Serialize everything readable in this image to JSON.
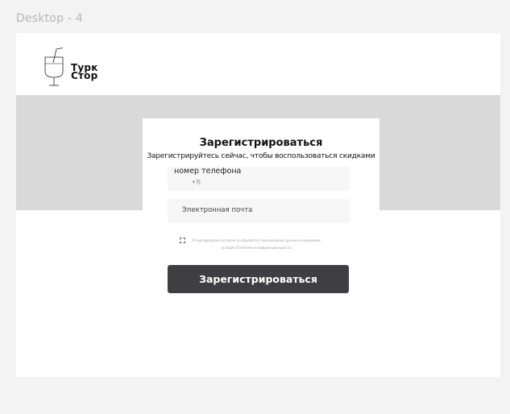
{
  "frame": {
    "label": "Desktop - 4"
  },
  "logo": {
    "line1": "Турк",
    "line2": "Стор",
    "icon": "glass-with-straw-icon"
  },
  "form": {
    "title": "Зарегистрироваться",
    "subtitle": "Зарегистрируйтесь сейчас, чтобы воспользоваться скидками",
    "phone": {
      "label": "номер телефона",
      "value": "+7|"
    },
    "email": {
      "placeholder": "Электронная почта"
    },
    "consent": {
      "checked": false,
      "text": "Я подтверждаю согласие на обработку персональных данных и принимаю условия Политики конфиденциальности"
    },
    "submit_label": "Зарегистрироваться"
  },
  "colors": {
    "page_bg": "#f3f3f3",
    "band_bg": "#d9d9d9",
    "field_bg": "#f6f6f6",
    "button_bg": "#3f3f43",
    "button_text": "#ffffff"
  }
}
